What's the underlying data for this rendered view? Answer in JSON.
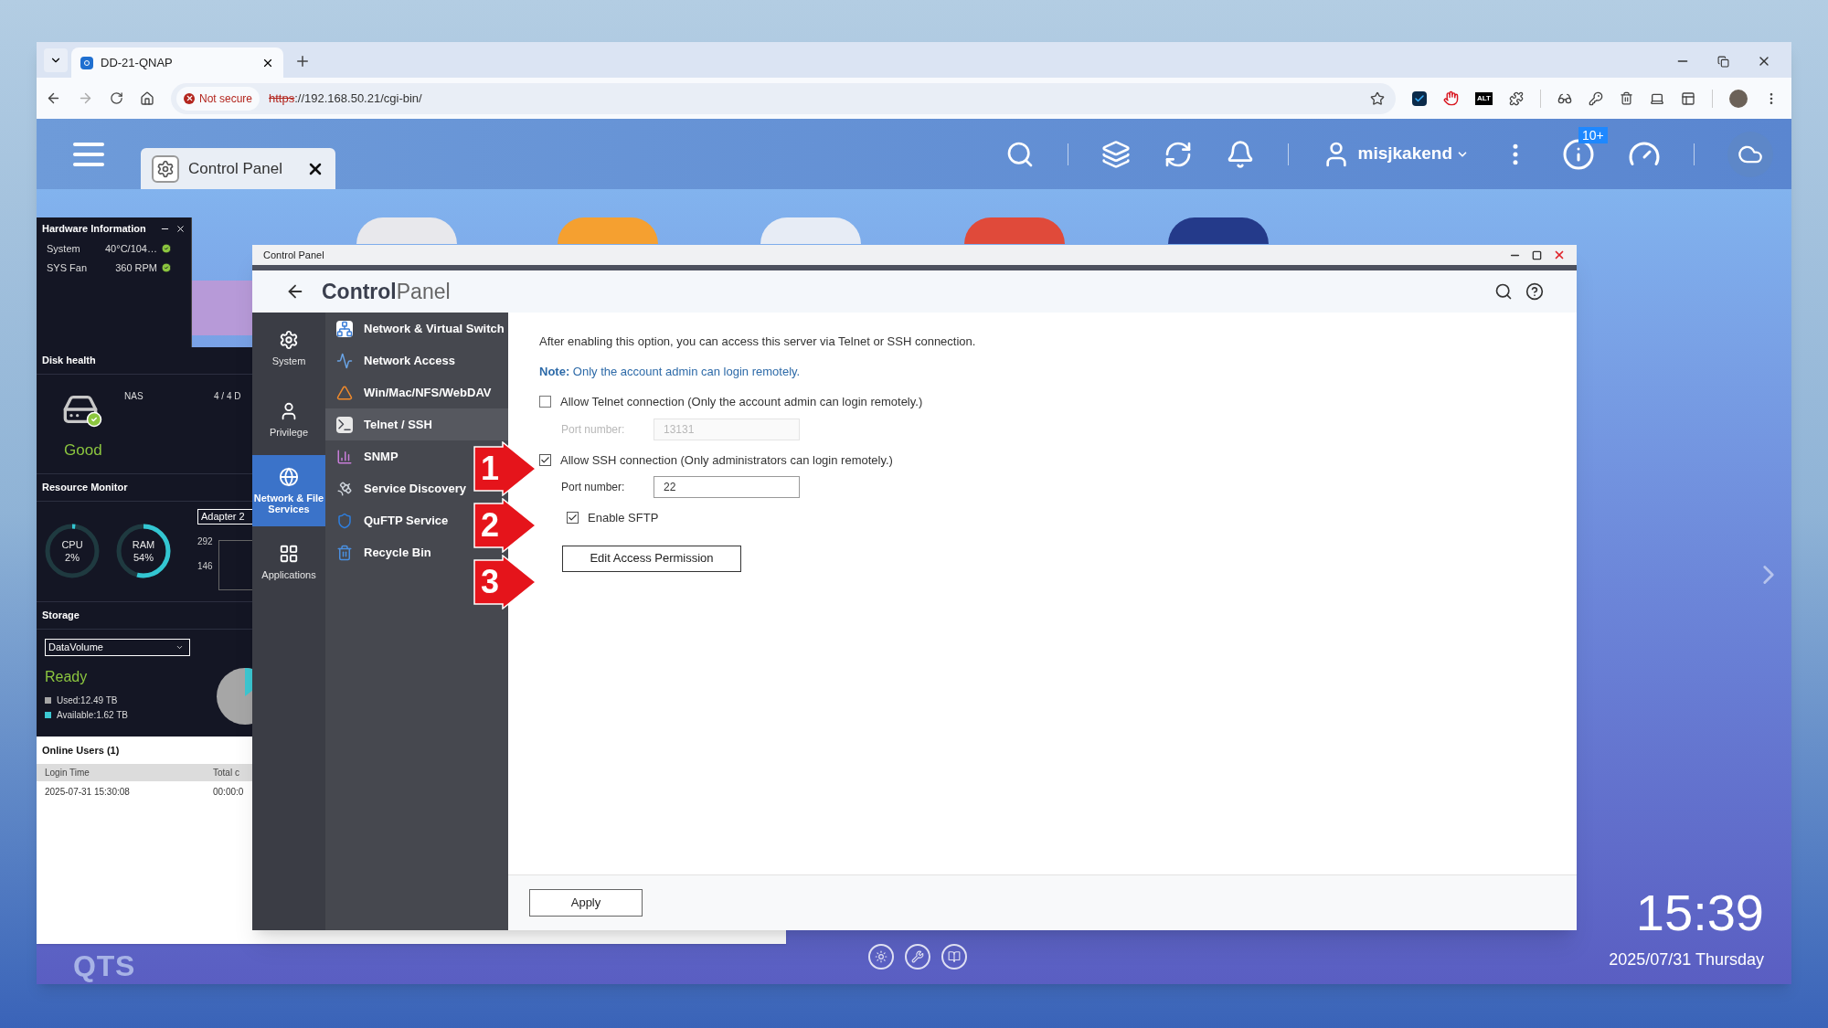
{
  "browser": {
    "tabs": [
      {
        "title": "DD-21-QNAP",
        "selected": true
      }
    ],
    "address": {
      "security": "Not secure",
      "scheme": "https",
      "rest": "://192.168.50.21/cgi-bin/"
    },
    "extension_label": "ALT"
  },
  "qts_bar": {
    "app_tabs": [
      {
        "label": "Control Panel",
        "selected": true
      }
    ],
    "user": "misjkakend",
    "badge": "10+"
  },
  "widgets": {
    "hardware": {
      "title": "Hardware Information",
      "rows": [
        {
          "label": "System",
          "value": "40°C/104…",
          "ok": true
        },
        {
          "label": "SYS Fan",
          "value": "360 RPM",
          "ok": true
        }
      ]
    },
    "disk_health": {
      "title": "Disk health",
      "name": "NAS",
      "count": "4 / 4 D",
      "status": "Good"
    },
    "resource": {
      "title": "Resource Monitor",
      "meters": [
        {
          "label": "CPU",
          "value": "2%",
          "level": 0.02
        },
        {
          "label": "RAM",
          "value": "54%",
          "level": 0.54
        }
      ],
      "adapter": "Adapter 2",
      "ticks": [
        "292",
        "146"
      ]
    },
    "storage": {
      "title": "Storage",
      "volume": "DataVolume",
      "status": "Ready",
      "legend": [
        {
          "label": "Used:12.49 TB",
          "color": "#a6a6a6"
        },
        {
          "label": "Available:1.62 TB",
          "color": "#3cc8d2"
        }
      ]
    },
    "online_users": {
      "title": "Online Users (1)",
      "columns": [
        "Login Time",
        "Total c"
      ],
      "rows": [
        [
          "2025-07-31 15:30:08",
          "00:00:0"
        ]
      ]
    }
  },
  "control_panel": {
    "window_title": "Control Panel",
    "heading_bold": "Control",
    "heading_light": "Panel",
    "categories": [
      {
        "label": "System",
        "selected": false
      },
      {
        "label": "Privilege",
        "selected": false
      },
      {
        "label": "Network & File Services",
        "selected": true
      },
      {
        "label": "Applications",
        "selected": false
      }
    ],
    "submenu": [
      {
        "label": "Network & Virtual Switch",
        "selected": false
      },
      {
        "label": "Network Access",
        "selected": false
      },
      {
        "label": "Win/Mac/NFS/WebDAV",
        "selected": false
      },
      {
        "label": "Telnet / SSH",
        "selected": true
      },
      {
        "label": "SNMP",
        "selected": false
      },
      {
        "label": "Service Discovery",
        "selected": false
      },
      {
        "label": "QuFTP Service",
        "selected": false
      },
      {
        "label": "Recycle Bin",
        "selected": false
      }
    ],
    "description": "After enabling this option, you can access this server via Telnet or SSH connection.",
    "note_label": "Note:",
    "note": "Only the account admin can login remotely.",
    "telnet": {
      "label": "Allow Telnet connection (Only the account admin can login remotely.)",
      "checked": false,
      "port_label": "Port number:",
      "port": "13131"
    },
    "ssh": {
      "label": "Allow SSH connection (Only administrators can login remotely.)",
      "checked": true,
      "port_label": "Port number:",
      "port": "22"
    },
    "sftp": {
      "label": "Enable SFTP",
      "checked": true
    },
    "edit_button": "Edit Access Permission",
    "apply_button": "Apply"
  },
  "annotations": [
    "1",
    "2",
    "3"
  ],
  "desktop": {
    "logo": "QTS",
    "time": "15:39",
    "date": "2025/07/31 Thursday"
  }
}
